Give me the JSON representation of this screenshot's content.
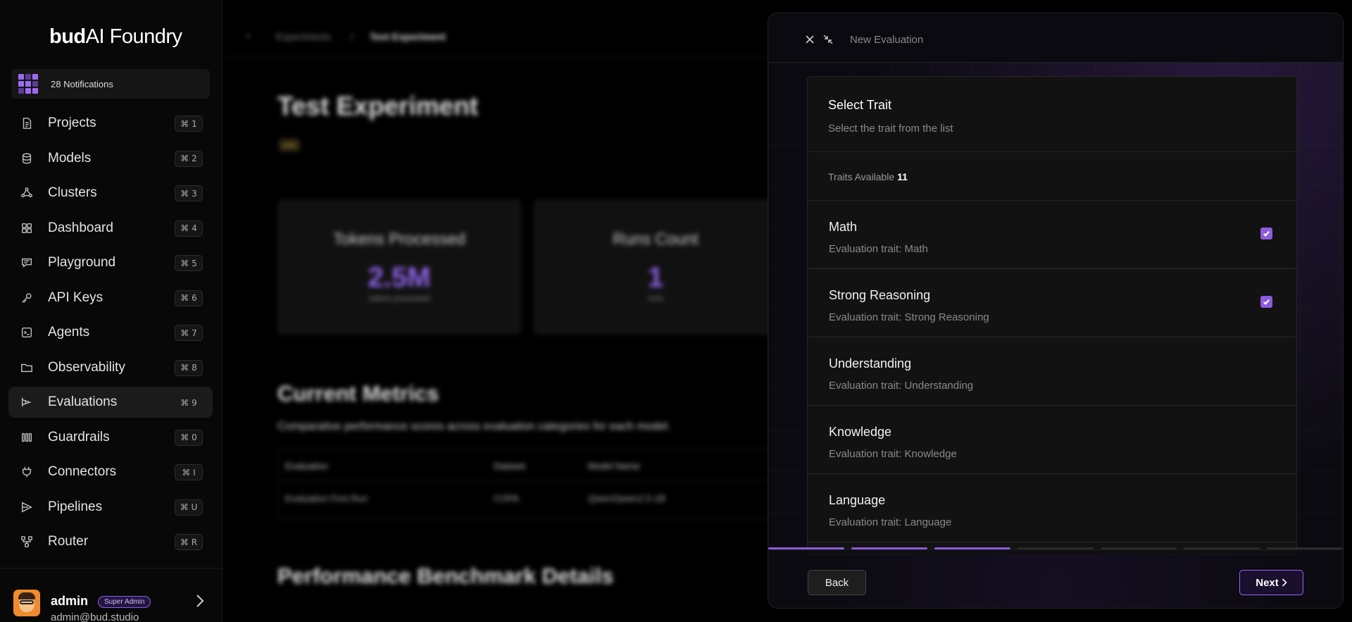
{
  "app": {
    "logo_bold": "bud",
    "logo_rest": "AI Foundry",
    "notifications_label": "28 Notifications"
  },
  "sidebar": {
    "items": [
      {
        "label": "Projects",
        "shortcut": "⌘ 1",
        "icon": "document-icon"
      },
      {
        "label": "Models",
        "shortcut": "⌘ 2",
        "icon": "database-icon"
      },
      {
        "label": "Clusters",
        "shortcut": "⌘ 3",
        "icon": "cluster-icon"
      },
      {
        "label": "Dashboard",
        "shortcut": "⌘ 4",
        "icon": "grid-icon"
      },
      {
        "label": "Playground",
        "shortcut": "⌘ 5",
        "icon": "chat-icon"
      },
      {
        "label": "API Keys",
        "shortcut": "⌘ 6",
        "icon": "key-icon"
      },
      {
        "label": "Agents",
        "shortcut": "⌘ 7",
        "icon": "terminal-icon"
      },
      {
        "label": "Observability",
        "shortcut": "⌘ 8",
        "icon": "folder-icon"
      },
      {
        "label": "Evaluations",
        "shortcut": "⌘ 9",
        "icon": "evaluation-icon"
      },
      {
        "label": "Guardrails",
        "shortcut": "⌘ 0",
        "icon": "guardrail-icon"
      },
      {
        "label": "Connectors",
        "shortcut": "⌘ I",
        "icon": "plug-icon"
      },
      {
        "label": "Pipelines",
        "shortcut": "⌘ U",
        "icon": "pipeline-icon"
      },
      {
        "label": "Router",
        "shortcut": "⌘ R",
        "icon": "router-icon"
      }
    ],
    "active_index": 8
  },
  "user": {
    "name": "admin",
    "role": "Super Admin",
    "email": "admin@bud.studio"
  },
  "background": {
    "breadcrumb_root": "Experiments",
    "breadcrumb_sep": "/",
    "breadcrumb_current": "Test Experiment",
    "title": "Test Experiment",
    "tag": "Live",
    "stats": [
      {
        "label": "Tokens Processed",
        "value": "2.5M",
        "sub": "tokens processed"
      },
      {
        "label": "Runs Count",
        "value": "1",
        "sub": "runs"
      }
    ],
    "metrics_title": "Current Metrics",
    "metrics_desc": "Comparative performance scores across evaluation categories for each model.",
    "table_headers": [
      "Evaluation",
      "Dataset",
      "Model Name"
    ],
    "table_row": [
      "Evaluation First Run",
      "COPA",
      "Qwen/Qwen2.5-1B"
    ],
    "benchmark_title": "Performance Benchmark Details"
  },
  "drawer": {
    "title": "New Evaluation",
    "panel_title": "Select Trait",
    "panel_desc": "Select the trait from the list",
    "traits_available_label": "Traits Available",
    "traits_available_count": "11",
    "traits": [
      {
        "name": "Math",
        "desc": "Evaluation trait: Math",
        "checked": true
      },
      {
        "name": "Strong Reasoning",
        "desc": "Evaluation trait: Strong Reasoning",
        "checked": true
      },
      {
        "name": "Understanding",
        "desc": "Evaluation trait: Understanding",
        "checked": false
      },
      {
        "name": "Knowledge",
        "desc": "Evaluation trait: Knowledge",
        "checked": false
      },
      {
        "name": "Language",
        "desc": "Evaluation trait: Language",
        "checked": false
      }
    ],
    "steps_total": 7,
    "steps_done": 3,
    "back_label": "Back",
    "next_label": "Next",
    "accent_color": "#8d5bdd"
  }
}
